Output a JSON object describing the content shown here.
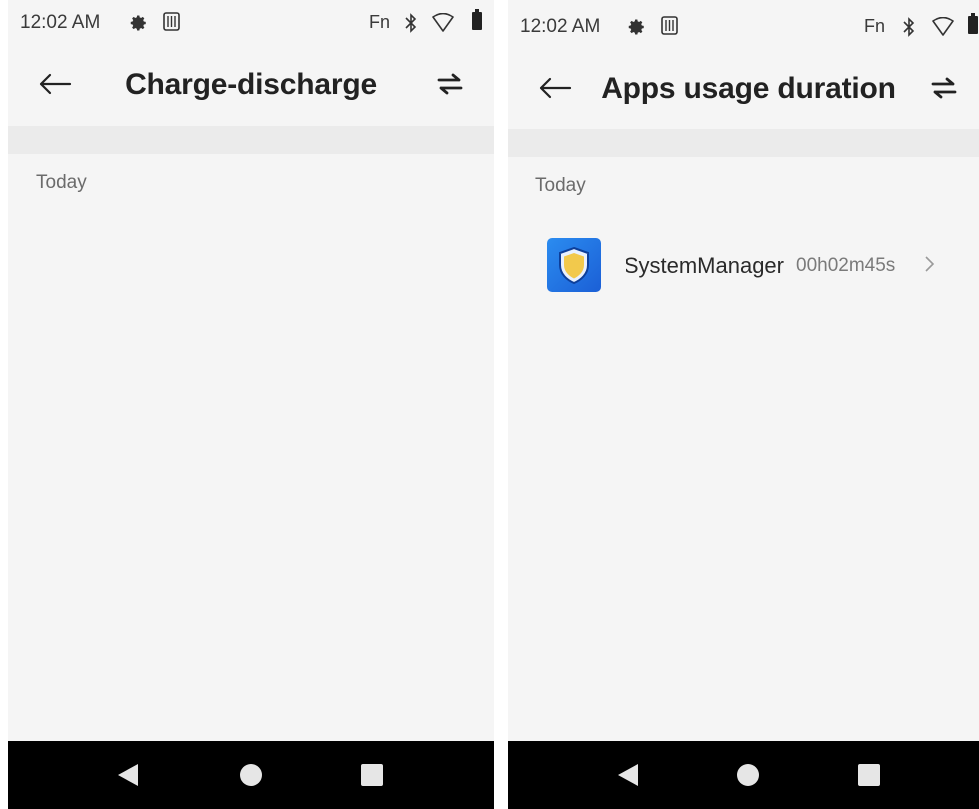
{
  "left_screen": {
    "status_bar": {
      "time": "12:02 AM",
      "fn": "Fn"
    },
    "title": "Charge-discharge",
    "section_label": "Today"
  },
  "right_screen": {
    "status_bar": {
      "time": "12:02 AM",
      "fn": "Fn"
    },
    "title": "Apps usage duration",
    "section_label": "Today",
    "apps": [
      {
        "name": "SystemManager",
        "duration": "00h02m45s",
        "icon": "shield-icon"
      }
    ]
  },
  "icons": {
    "back": "arrow-left-icon",
    "swap": "swap-arrows-icon",
    "nav_back": "triangle-back-icon",
    "nav_home": "circle-home-icon",
    "nav_recents": "square-recents-icon"
  },
  "colors": {
    "screen_bg": "#f5f5f5",
    "band": "#ebebeb",
    "title": "#222222",
    "nav_bar": "#000000",
    "app_icon": "#2b8cf0",
    "shield": "#f2c94c"
  }
}
